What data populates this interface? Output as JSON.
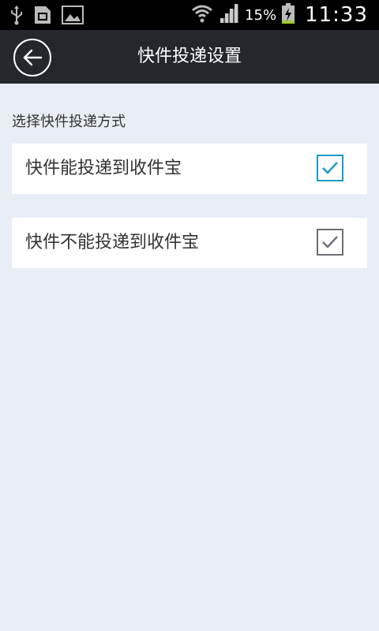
{
  "status_bar": {
    "battery_percent": "15%",
    "time": "11:33",
    "icons": [
      "usb-icon",
      "sim-card-icon",
      "image-icon",
      "wifi-icon",
      "signal-icon",
      "battery-charging-icon"
    ]
  },
  "header": {
    "title": "快件投递设置",
    "back_icon": "back-arrow-icon"
  },
  "main": {
    "section_label": "选择快件投递方式",
    "options": [
      {
        "label": "快件能投递到收件宝",
        "checked": true,
        "accent": "#1a9bc7"
      },
      {
        "label": "快件不能投递到收件宝",
        "checked": true,
        "accent": "#6e7076"
      }
    ]
  },
  "colors": {
    "app_bar": "#24272c",
    "background": "#e9edf5"
  }
}
